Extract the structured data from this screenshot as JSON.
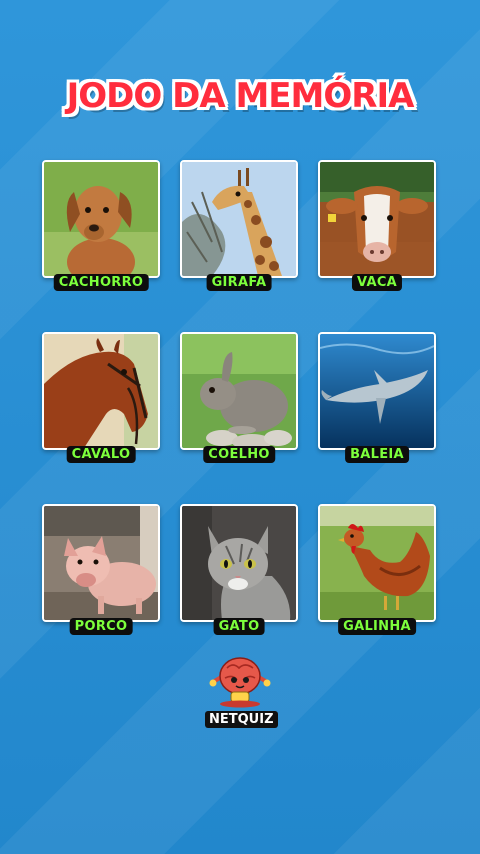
{
  "title": "JODO DA MEMÓRIA",
  "cards": [
    {
      "label": "CACHORRO",
      "icon": "dog-photo"
    },
    {
      "label": "GIRAFA",
      "icon": "giraffe-photo"
    },
    {
      "label": "VACA",
      "icon": "cow-photo"
    },
    {
      "label": "CAVALO",
      "icon": "horse-photo"
    },
    {
      "label": "COELHO",
      "icon": "rabbit-photo"
    },
    {
      "label": "BALEIA",
      "icon": "whale-photo"
    },
    {
      "label": "PORCO",
      "icon": "pig-photo"
    },
    {
      "label": "GATO",
      "icon": "cat-photo"
    },
    {
      "label": "GALINHA",
      "icon": "chicken-photo"
    }
  ],
  "logo": {
    "text": "NETQUIZ",
    "icon": "brain-mascot-icon"
  },
  "colors": {
    "background": "#2a8fd4",
    "title": "#ff2d3d",
    "label_text": "#7dff3c",
    "label_bg": "#0d0d0d"
  }
}
